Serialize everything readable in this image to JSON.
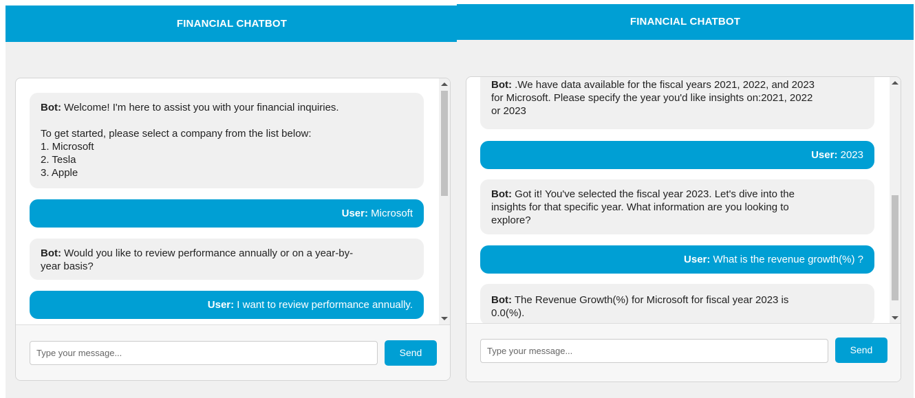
{
  "panels": [
    {
      "header_title": "FINANCIAL CHATBOT",
      "messages": [
        {
          "role": "bot",
          "label": "Bot:",
          "text": " Welcome! I'm here to assist you with your financial inquiries.\n\nTo get started, please select a company from the list below:\n1. Microsoft\n2. Tesla\n3. Apple"
        },
        {
          "role": "user",
          "label": "User:",
          "text": " Microsoft"
        },
        {
          "role": "bot",
          "label": "Bot:",
          "text": " Would you like to review performance annually or on a year-by-\nyear basis?"
        },
        {
          "role": "user",
          "label": "User:",
          "text": " I want to review performance annually."
        }
      ],
      "input_placeholder": "Type your message...",
      "send_label": "Send"
    },
    {
      "header_title": "FINANCIAL CHATBOT",
      "messages": [
        {
          "role": "bot",
          "label": "Bot:",
          "text": " .We have data available for the fiscal years 2021, 2022, and 2023\nfor Microsoft. Please specify the year you'd like insights on:2021, 2022\nor 2023"
        },
        {
          "role": "user",
          "label": "User:",
          "text": " 2023"
        },
        {
          "role": "bot",
          "label": "Bot:",
          "text": " Got it! You've selected the fiscal year 2023. Let's dive into the\ninsights for that specific year. What information are you looking to\nexplore?"
        },
        {
          "role": "user",
          "label": "User:",
          "text": " What is the revenue growth(%) ?"
        },
        {
          "role": "bot",
          "label": "Bot:",
          "text": " The Revenue Growth(%) for Microsoft for fiscal year 2023 is\n0.0(%)."
        }
      ],
      "input_placeholder": "Type your message...",
      "send_label": "Send"
    }
  ],
  "colors": {
    "accent": "#009fd4",
    "bot_bubble": "#f0f0f0",
    "page_background": "#f0f0f0"
  },
  "icons": [
    "scroll-up-arrow-icon",
    "scroll-down-arrow-icon"
  ]
}
